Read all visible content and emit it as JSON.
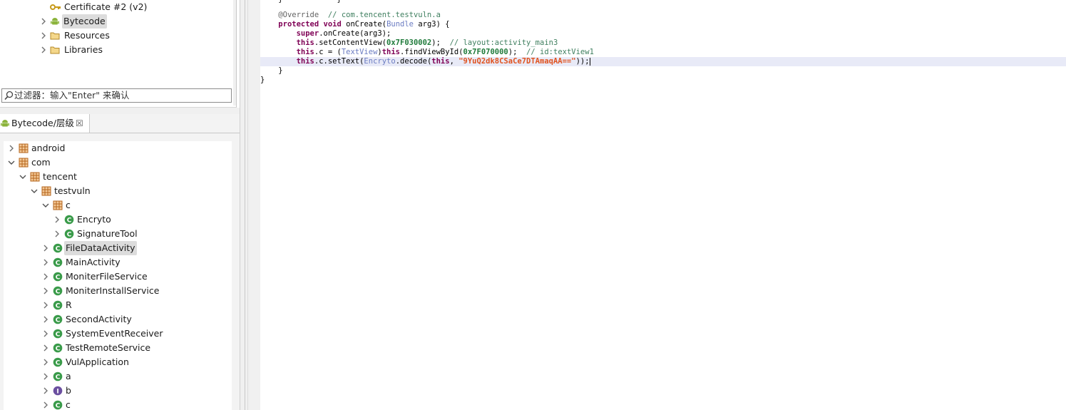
{
  "top_tree": {
    "items": [
      {
        "label": "Certificate #2 (v2)",
        "icon": "key-icon"
      },
      {
        "label": "Bytecode",
        "icon": "android-icon",
        "selected": true
      },
      {
        "label": "Resources",
        "icon": "folder-icon"
      },
      {
        "label": "Libraries",
        "icon": "folder-icon"
      }
    ]
  },
  "filter": {
    "text": "过滤器：输入\"Enter\" 来确认"
  },
  "hierarchy_tab": {
    "label": "Bytecode/层级",
    "close": "☒"
  },
  "tree": {
    "nodes": [
      {
        "label": "android",
        "icon": "package-icon",
        "state": "collapsed"
      },
      {
        "label": "com",
        "icon": "package-icon",
        "state": "expanded"
      },
      {
        "label": "tencent",
        "icon": "package-icon",
        "state": "expanded"
      },
      {
        "label": "testvuln",
        "icon": "package-icon",
        "state": "expanded"
      },
      {
        "label": "c",
        "icon": "package-icon",
        "state": "expanded"
      },
      {
        "label": "Encryto",
        "icon": "class-icon",
        "state": "collapsed"
      },
      {
        "label": "SignatureTool",
        "icon": "class-icon",
        "state": "collapsed"
      },
      {
        "label": "FileDataActivity",
        "icon": "class-icon",
        "state": "collapsed",
        "selected": true
      },
      {
        "label": "MainActivity",
        "icon": "class-icon",
        "state": "collapsed"
      },
      {
        "label": "MoniterFileService",
        "icon": "class-icon",
        "state": "collapsed"
      },
      {
        "label": "MoniterInstallService",
        "icon": "class-icon",
        "state": "collapsed"
      },
      {
        "label": "R",
        "icon": "class-icon",
        "state": "collapsed"
      },
      {
        "label": "SecondActivity",
        "icon": "class-icon",
        "state": "collapsed"
      },
      {
        "label": "SystemEventReceiver",
        "icon": "class-icon",
        "state": "collapsed"
      },
      {
        "label": "TestRemoteService",
        "icon": "class-icon",
        "state": "collapsed"
      },
      {
        "label": "VulApplication",
        "icon": "class-icon",
        "state": "collapsed"
      },
      {
        "label": "a",
        "icon": "class-icon",
        "state": "collapsed"
      },
      {
        "label": "b",
        "icon": "interface-icon",
        "state": "collapsed"
      },
      {
        "label": "c",
        "icon": "class-icon",
        "state": "collapsed"
      }
    ]
  },
  "code": {
    "l1": {
      "anno": "@Override",
      "cm": "// com.tencent.testvuln.a"
    },
    "l2": {
      "kw1": "protected",
      "kw2": "void",
      "name": "onCreate(",
      "type": "Bundle",
      "rest": " arg3) {"
    },
    "l3": {
      "kw": "super",
      "rest": ".onCreate(arg3);"
    },
    "l4": {
      "kw": "this",
      "rest": ".setContentView(",
      "hex": "0x7F030002",
      "tail": ");",
      "cm": "// layout:activity_main3"
    },
    "l5": {
      "kw": "this",
      "a": ".c = (",
      "type": "TextView",
      "b": ")",
      "kw2": "this",
      "c": ".findViewById(",
      "hex": "0x7F070000",
      "tail": ");",
      "cm": "// id:textView1"
    },
    "l6": {
      "kw": "this",
      "a": ".c.setText(",
      "type": "Encryto",
      "b": ".decode(",
      "kw2": "this",
      "c": ", ",
      "str": "\"9YuQ2dk8CSaCe7DTAmaqAA==\"",
      "tail": "));"
    },
    "l7": "}",
    "l8": "}"
  },
  "colors": {
    "keyword": "#7f0055",
    "comment": "#3f7f5f",
    "string": "#e0521f",
    "number": "#1f7a3a",
    "type": "#6b7cc2",
    "highlight_line": "#e8eaf7",
    "class_icon": "#3a9b4a",
    "interface_icon": "#6b4fa0",
    "package_icon": "#b5651d"
  }
}
